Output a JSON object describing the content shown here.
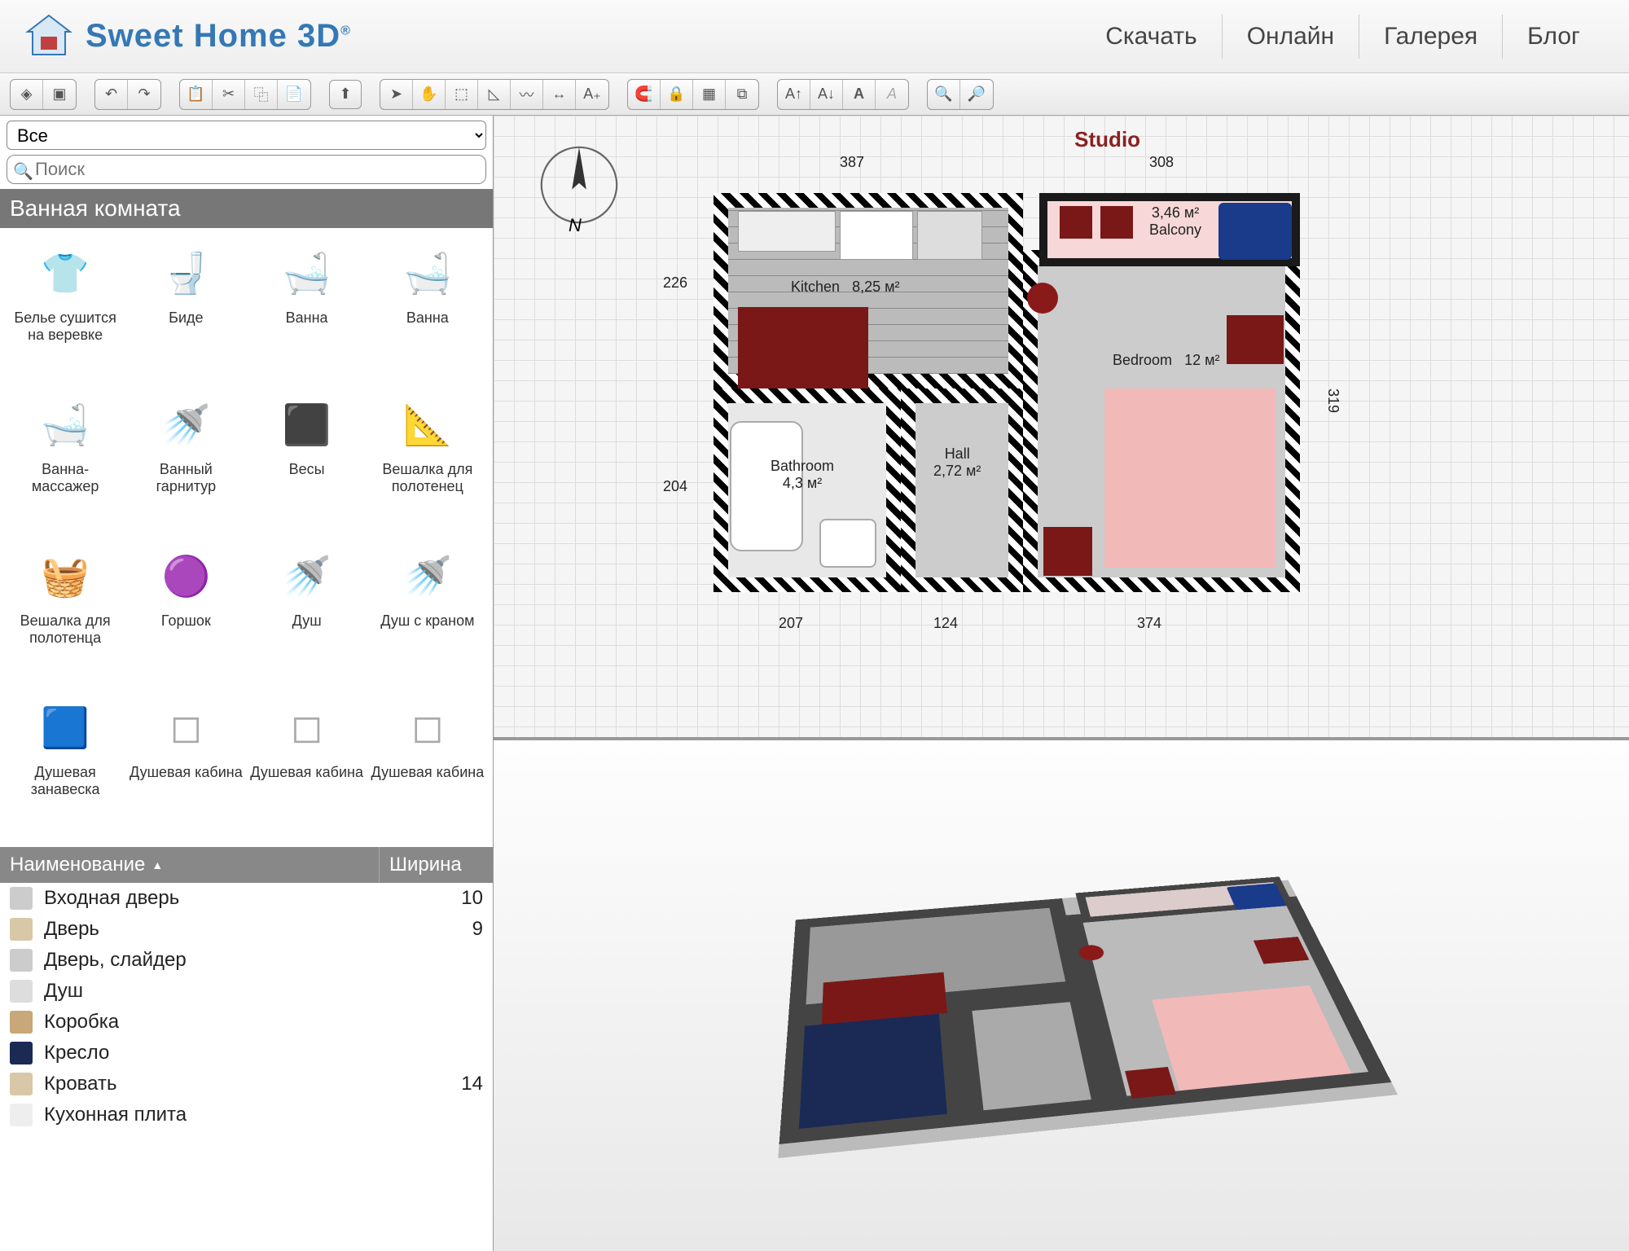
{
  "app": {
    "name": "Sweet Home 3D",
    "registered": "®"
  },
  "nav": {
    "download": "Скачать",
    "online": "Онлайн",
    "gallery": "Галерея",
    "blog": "Блог"
  },
  "sidebar": {
    "filter_all": "Все",
    "search_placeholder": "Поиск",
    "category": "Ванная комната",
    "items": [
      "Белье сушится на веревке",
      "Биде",
      "Ванна",
      "Ванна",
      "Ванна-массажер",
      "Ванный гарнитур",
      "Весы",
      "Вешалка для полотенец",
      "Вешалка для полотенца",
      "Горшок",
      "Душ",
      "Душ с краном",
      "Душевая занавеска",
      "Душевая кабина",
      "Душевая кабина",
      "Душевая кабина"
    ],
    "table": {
      "col_name": "Наименование",
      "col_width": "Ширина",
      "rows": [
        {
          "name": "Входная дверь",
          "width": "10"
        },
        {
          "name": "Дверь",
          "width": "9"
        },
        {
          "name": "Дверь, слайдер",
          "width": ""
        },
        {
          "name": "Душ",
          "width": ""
        },
        {
          "name": "Коробка",
          "width": ""
        },
        {
          "name": "Кресло",
          "width": ""
        },
        {
          "name": "Кровать",
          "width": "14"
        },
        {
          "name": "Кухонная плита",
          "width": ""
        }
      ]
    }
  },
  "plan": {
    "title": "Studio",
    "rooms": {
      "kitchen": {
        "name": "Kitchen",
        "area": "8,25 м²"
      },
      "balcony": {
        "name": "Balcony",
        "area": "3,46 м²"
      },
      "bedroom": {
        "name": "Bedroom",
        "area": "12 м²"
      },
      "bathroom": {
        "name": "Bathroom",
        "area": "4,3 м²"
      },
      "hall": {
        "name": "Hall",
        "area": "2,72 м²"
      }
    },
    "dims": {
      "top_left": "387",
      "top_right": "308",
      "left_upper": "226",
      "left_lower": "204",
      "right": "319",
      "bottom_left": "207",
      "bottom_mid": "124",
      "bottom_right": "374"
    },
    "compass_label": "N"
  },
  "icons": {
    "thumbs": [
      "👕",
      "🚽",
      "🛁",
      "🛁",
      "🛁",
      "🚿",
      "⬛",
      "📐",
      "🧺",
      "🟣",
      "🚿",
      "🚿",
      "🟦",
      "◻",
      "◻",
      "◻"
    ]
  }
}
